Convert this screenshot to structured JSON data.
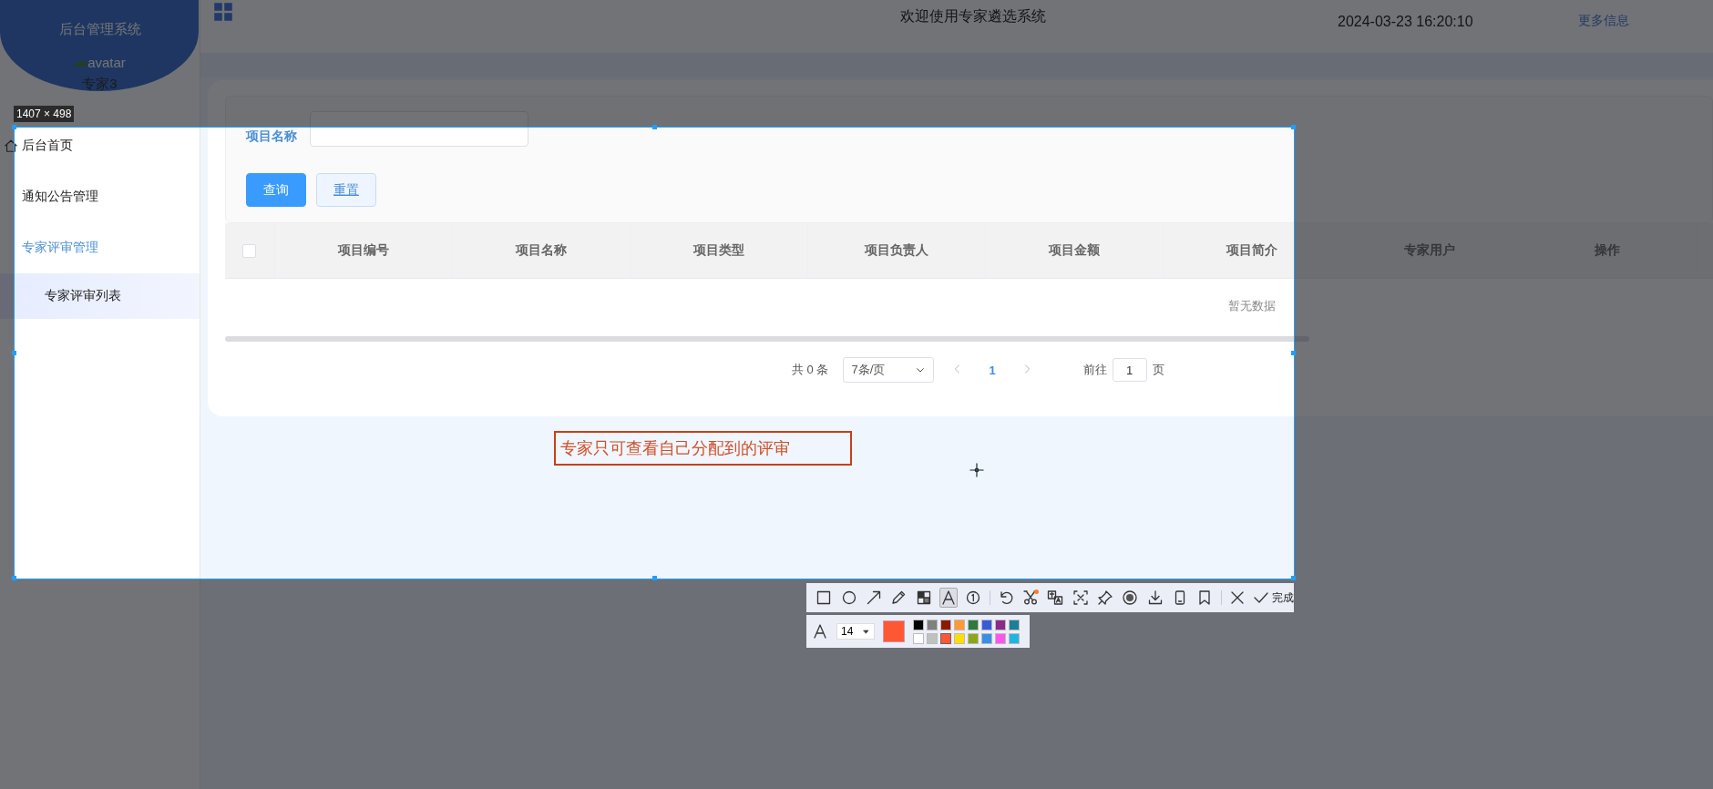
{
  "sidebar": {
    "title": "后台管理系统",
    "avatar_alt": "avatar",
    "username": "专家3",
    "items": [
      {
        "label": "后台首页",
        "kind": "home",
        "selected": false,
        "expanded": false
      },
      {
        "label": "通知公告管理",
        "kind": "plain",
        "selected": false,
        "expanded": false
      },
      {
        "label": "专家评审管理",
        "kind": "plain",
        "selected": false,
        "expanded": true,
        "children": [
          {
            "label": "专家评审列表",
            "selected": true
          }
        ]
      }
    ]
  },
  "header": {
    "title": "欢迎使用专家遴选系统",
    "datetime": "2024-03-23 16:20:10",
    "more_link": "更多信息"
  },
  "search": {
    "label": "项目名称",
    "buttons": [
      {
        "label": "查询",
        "kind": "primary"
      },
      {
        "label": "重置",
        "kind": "plain"
      }
    ]
  },
  "table": {
    "select_all_checked": false,
    "columns": [
      "项目编号",
      "项目名称",
      "项目类型",
      "项目负责人",
      "项目金额",
      "项目简介",
      "专家用户",
      "操作"
    ],
    "empty_text": "暂无数据"
  },
  "pagination": {
    "total": "共 0 条",
    "page_size": "7条/页",
    "pages": [
      {
        "label": "1",
        "selected": true
      }
    ],
    "goto_label": "前往",
    "goto_value": "1",
    "goto_suffix": "页"
  },
  "capture": {
    "size_label": "1407 × 498",
    "annotation": "专家只可查看自己分配到的评审",
    "tool_groups": [
      [
        {
          "kind": "rect",
          "selected": false,
          "badge": false
        },
        {
          "kind": "ellipse",
          "selected": false,
          "badge": false
        },
        {
          "kind": "arrow",
          "selected": false,
          "badge": false
        },
        {
          "kind": "pencil",
          "selected": false,
          "badge": false
        },
        {
          "kind": "mosaic",
          "selected": false,
          "badge": false
        },
        {
          "kind": "text",
          "selected": true,
          "badge": false
        },
        {
          "kind": "number",
          "selected": false,
          "badge": false
        }
      ],
      [
        {
          "kind": "undo",
          "selected": false,
          "badge": false
        },
        {
          "kind": "cut",
          "selected": false,
          "badge": true
        },
        {
          "kind": "translate",
          "selected": false,
          "badge": false
        },
        {
          "kind": "ocr",
          "selected": false,
          "badge": false
        },
        {
          "kind": "pin",
          "selected": false,
          "badge": false
        },
        {
          "kind": "record",
          "selected": false,
          "badge": false
        },
        {
          "kind": "download",
          "selected": false,
          "badge": false
        },
        {
          "kind": "phone",
          "selected": false,
          "badge": false
        },
        {
          "kind": "bookmark",
          "selected": false,
          "badge": false
        }
      ],
      [
        {
          "kind": "close",
          "selected": false,
          "badge": false
        }
      ]
    ],
    "done_label": "完成",
    "font_size": "14",
    "palette": [
      {
        "color": "#000000",
        "selected": false
      },
      {
        "color": "#808080",
        "selected": false
      },
      {
        "color": "#8b1a00",
        "selected": false
      },
      {
        "color": "#ff9933",
        "selected": false
      },
      {
        "color": "#2d7a3a",
        "selected": false
      },
      {
        "color": "#3a5bd9",
        "selected": false
      },
      {
        "color": "#8b2a8b",
        "selected": false
      },
      {
        "color": "#1a8099",
        "selected": false
      },
      {
        "color": "#ffffff",
        "selected": false
      },
      {
        "color": "#c0c0c0",
        "selected": false
      },
      {
        "color": "#ff5733",
        "selected": true
      },
      {
        "color": "#ffdd00",
        "selected": false
      },
      {
        "color": "#8da617",
        "selected": false
      },
      {
        "color": "#3a8ee6",
        "selected": false
      },
      {
        "color": "#ff55ee",
        "selected": false
      },
      {
        "color": "#1fb5e0",
        "selected": false
      }
    ]
  }
}
